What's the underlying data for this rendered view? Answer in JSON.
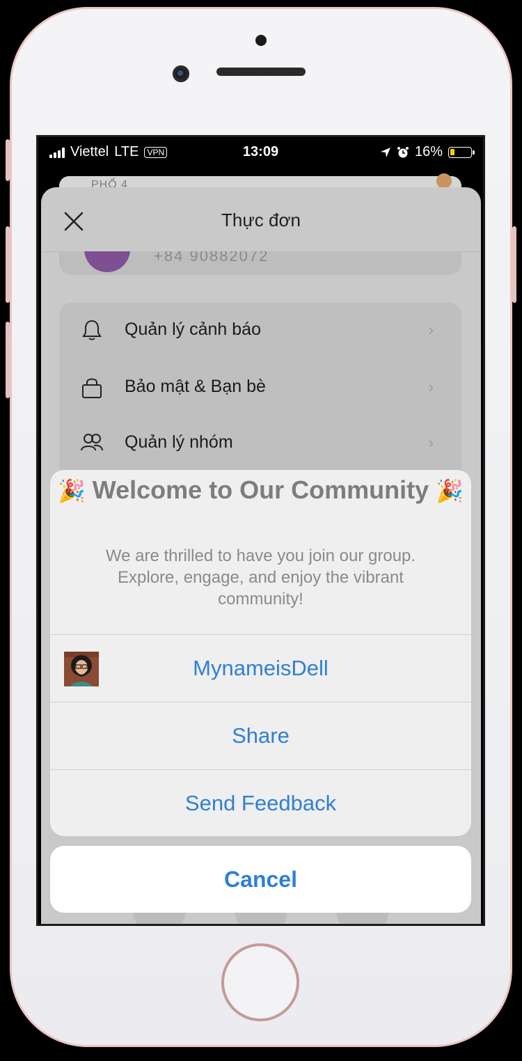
{
  "status_bar": {
    "carrier": "Viettel",
    "network": "LTE",
    "vpn": "VPN",
    "time": "13:09",
    "battery": "16%"
  },
  "map": {
    "street_label": "PHỐ 4"
  },
  "sheet": {
    "title": "Thực đơn",
    "profile_phone": "+84 90882072",
    "menu": [
      {
        "label": "Quản lý cảnh báo",
        "icon": "bell-icon"
      },
      {
        "label": "Bảo mật & Bạn bè",
        "icon": "lock-icon"
      },
      {
        "label": "Quản lý nhóm",
        "icon": "group-icon"
      }
    ]
  },
  "action_sheet": {
    "title": "Welcome to Our Community",
    "title_emoji": "🎉",
    "message": "We are thrilled to have you join our group. Explore, engage, and enjoy the vibrant community!",
    "actions": [
      {
        "label": "MynameisDell",
        "icon": "user-avatar"
      },
      {
        "label": "Share"
      },
      {
        "label": "Send Feedback"
      }
    ],
    "cancel_label": "Cancel"
  },
  "colors": {
    "action_blue": "#2f7fd6",
    "dim_overlay": "#c9c9c9",
    "battery_low": "#f5d000"
  }
}
